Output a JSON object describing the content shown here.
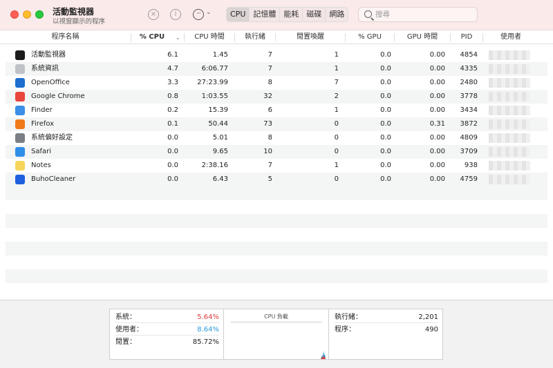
{
  "window": {
    "title": "活動監視器",
    "subtitle": "以視窗顯示的程序"
  },
  "toolbar": {
    "stop_icon": "x-circle-icon",
    "info_icon": "info-icon",
    "more_icon": "ellipsis-icon",
    "tabs": [
      {
        "label": "CPU",
        "active": true
      },
      {
        "label": "記憶體",
        "active": false
      },
      {
        "label": "能耗",
        "active": false
      },
      {
        "label": "磁碟",
        "active": false
      },
      {
        "label": "網路",
        "active": false
      }
    ],
    "search_placeholder": "搜尋"
  },
  "table": {
    "columns": [
      "程序名稱",
      "% CPU",
      "CPU 時間",
      "執行緒",
      "閒置喚醒",
      "% GPU",
      "GPU 時間",
      "PID",
      "使用者"
    ],
    "sorted_column": "% CPU",
    "rows": [
      {
        "name": "活動監視器",
        "icon": "activity-monitor-icon",
        "icon_color": "#1c1c1c",
        "cpu": "6.1",
        "cpu_time": "1.45",
        "threads": "7",
        "idle_wake": "1",
        "gpu": "0.0",
        "gpu_time": "0.00",
        "pid": "4854"
      },
      {
        "name": "系統資訊",
        "icon": "system-information-icon",
        "icon_color": "#bfc3c8",
        "cpu": "4.7",
        "cpu_time": "6:06.77",
        "threads": "7",
        "idle_wake": "1",
        "gpu": "0.0",
        "gpu_time": "0.00",
        "pid": "4335"
      },
      {
        "name": "OpenOffice",
        "icon": "openoffice-icon",
        "icon_color": "#1e6fd0",
        "cpu": "3.3",
        "cpu_time": "27:23.99",
        "threads": "8",
        "idle_wake": "7",
        "gpu": "0.0",
        "gpu_time": "0.00",
        "pid": "2480"
      },
      {
        "name": "Google Chrome",
        "icon": "google-chrome-icon",
        "icon_color": "#e8453c",
        "cpu": "0.8",
        "cpu_time": "1:03.55",
        "threads": "32",
        "idle_wake": "2",
        "gpu": "0.0",
        "gpu_time": "0.00",
        "pid": "3778"
      },
      {
        "name": "Finder",
        "icon": "finder-icon",
        "icon_color": "#3b8fe6",
        "cpu": "0.2",
        "cpu_time": "15.39",
        "threads": "6",
        "idle_wake": "1",
        "gpu": "0.0",
        "gpu_time": "0.00",
        "pid": "3434"
      },
      {
        "name": "Firefox",
        "icon": "firefox-icon",
        "icon_color": "#f07a1a",
        "cpu": "0.1",
        "cpu_time": "50.44",
        "threads": "73",
        "idle_wake": "0",
        "gpu": "0.0",
        "gpu_time": "0.31",
        "pid": "3872"
      },
      {
        "name": "系統偏好設定",
        "icon": "system-preferences-icon",
        "icon_color": "#7b7f85",
        "cpu": "0.0",
        "cpu_time": "5.01",
        "threads": "8",
        "idle_wake": "0",
        "gpu": "0.0",
        "gpu_time": "0.00",
        "pid": "4809"
      },
      {
        "name": "Safari",
        "icon": "safari-icon",
        "icon_color": "#2f8ee8",
        "cpu": "0.0",
        "cpu_time": "9.65",
        "threads": "10",
        "idle_wake": "0",
        "gpu": "0.0",
        "gpu_time": "0.00",
        "pid": "3709"
      },
      {
        "name": "Notes",
        "icon": "notes-icon",
        "icon_color": "#f6d55b",
        "cpu": "0.0",
        "cpu_time": "2:38.16",
        "threads": "7",
        "idle_wake": "1",
        "gpu": "0.0",
        "gpu_time": "0.00",
        "pid": "938"
      },
      {
        "name": "BuhoCleaner",
        "icon": "buhocleaner-icon",
        "icon_color": "#1f5fe0",
        "cpu": "0.0",
        "cpu_time": "6.43",
        "threads": "5",
        "idle_wake": "0",
        "gpu": "0.0",
        "gpu_time": "0.00",
        "pid": "4759"
      }
    ]
  },
  "stats": {
    "system_label": "系統：",
    "system_value": "5.64%",
    "user_label": "使用者：",
    "user_value": "8.64%",
    "idle_label": "閒置：",
    "idle_value": "85.72%",
    "graph_title": "CPU 負載",
    "threads_label": "執行緒：",
    "threads_value": "2,201",
    "processes_label": "程序：",
    "processes_value": "490",
    "system_color": "#e03a3a",
    "user_color": "#2a9bd8"
  }
}
